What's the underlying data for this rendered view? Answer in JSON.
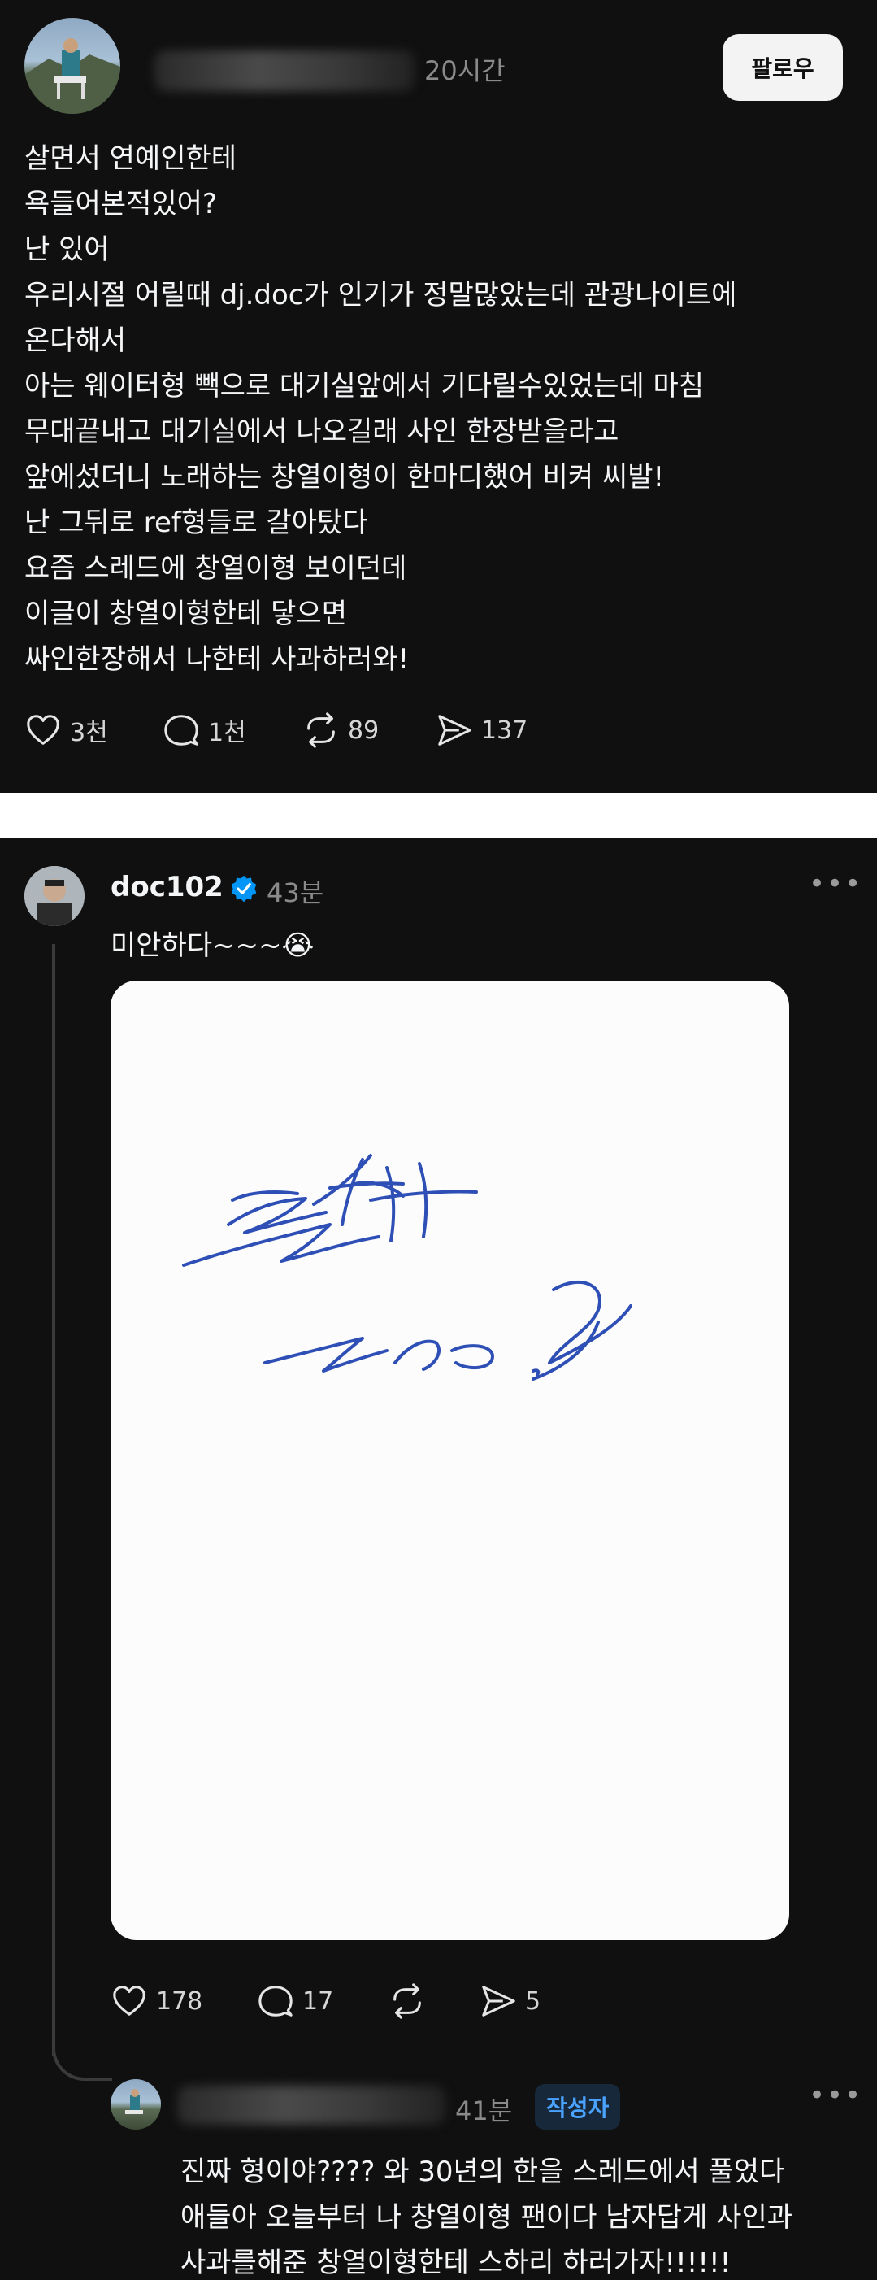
{
  "post": {
    "time": "20시간",
    "follow_label": "팔로우",
    "lines": [
      "살면서 연예인한테",
      "욕들어본적있어?",
      "난 있어",
      "우리시절 어릴때 dj.doc가 인기가 정말많았는데 관광나이트에",
      "온다해서",
      "아는 웨이터형 빽으로 대기실앞에서 기다릴수있었는데 마침",
      "무대끝내고 대기실에서 나오길래 사인 한장받을라고",
      "앞에섰더니 노래하는 창열이형이 한마디했어 비켜 씨발!",
      "난 그뒤로 ref형들로 갈아탔다",
      "요즘 스레드에 창열이형 보이던데",
      "이글이 창열이형한테 닿으면",
      "싸인한장해서 나한테 사과하러와!"
    ],
    "stats": {
      "likes": "3천",
      "comments": "1천",
      "reposts": "89",
      "shares": "137"
    }
  },
  "reply": {
    "username": "doc102",
    "time": "43분",
    "text": "미안하다~~~😭",
    "stats": {
      "likes": "178",
      "comments": "17",
      "shares": "5"
    }
  },
  "nested_reply": {
    "time": "41분",
    "author_badge": "작성자",
    "lines": [
      "진짜 형이야???? 와 30년의 한을 스레드에서 풀었다",
      "애들아 오늘부터 나 창열이형 팬이다 남자답게 사인과",
      "사과를해준 창열이형한테 스하리 하러가자!!!!!!"
    ]
  },
  "colors": {
    "background": "#101010",
    "separator": "#ffffff",
    "verified": "#0095f6",
    "badge_text": "#4aa3ff",
    "badge_bg": "#16283a"
  },
  "icons": [
    "heart-icon",
    "comment-icon",
    "repost-icon",
    "share-icon",
    "verified-icon",
    "more-icon"
  ]
}
